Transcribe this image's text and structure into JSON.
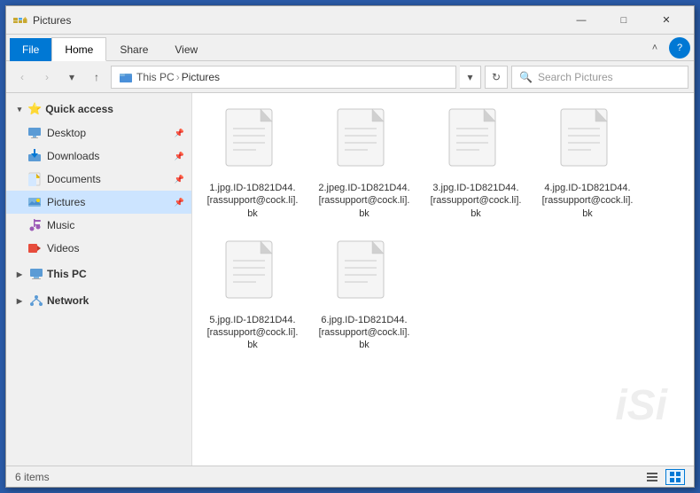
{
  "titlebar": {
    "title": "Pictures",
    "minimize": "—",
    "maximize": "□",
    "close": "✕"
  },
  "ribbon": {
    "file_label": "File",
    "tabs": [
      "Home",
      "Share",
      "View"
    ],
    "active_tab": "Home"
  },
  "qat": {
    "undo_label": "↩",
    "redo_label": "↪",
    "dropdown_label": "▾"
  },
  "address": {
    "back_label": "‹",
    "forward_label": "›",
    "up_label": "↑",
    "this_pc": "This PC",
    "location": "Pictures",
    "dropdown_label": "▾",
    "refresh_label": "↻",
    "search_placeholder": "Search Pictures"
  },
  "sidebar": {
    "quick_access_label": "Quick access",
    "quick_access_items": [
      {
        "name": "Desktop",
        "icon": "desktop",
        "pinned": true
      },
      {
        "name": "Downloads",
        "icon": "downloads",
        "pinned": true
      },
      {
        "name": "Documents",
        "icon": "documents",
        "pinned": true
      },
      {
        "name": "Pictures",
        "icon": "pictures",
        "pinned": true,
        "active": true
      },
      {
        "name": "Music",
        "icon": "music"
      },
      {
        "name": "Videos",
        "icon": "videos"
      }
    ],
    "this_pc_label": "This PC",
    "network_label": "Network"
  },
  "files": [
    {
      "name": "1.jpg.ID-1D821D44.[rassupport@cock.li].bk",
      "icon": "document"
    },
    {
      "name": "2.jpeg.ID-1D821D44.[rassupport@cock.li].bk",
      "icon": "document"
    },
    {
      "name": "3.jpg.ID-1D821D44.[rassupport@cock.li].bk",
      "icon": "document"
    },
    {
      "name": "4.jpg.ID-1D821D44.[rassupport@cock.li].bk",
      "icon": "document"
    },
    {
      "name": "5.jpg.ID-1D821D44.[rassupport@cock.li].bk",
      "icon": "document"
    },
    {
      "name": "6.jpg.ID-1D821D44.[rassupport@cock.li].bk",
      "icon": "document"
    }
  ],
  "status": {
    "item_count": "6 items"
  },
  "colors": {
    "accent": "#0078d4",
    "file_tab": "#0078d4"
  }
}
